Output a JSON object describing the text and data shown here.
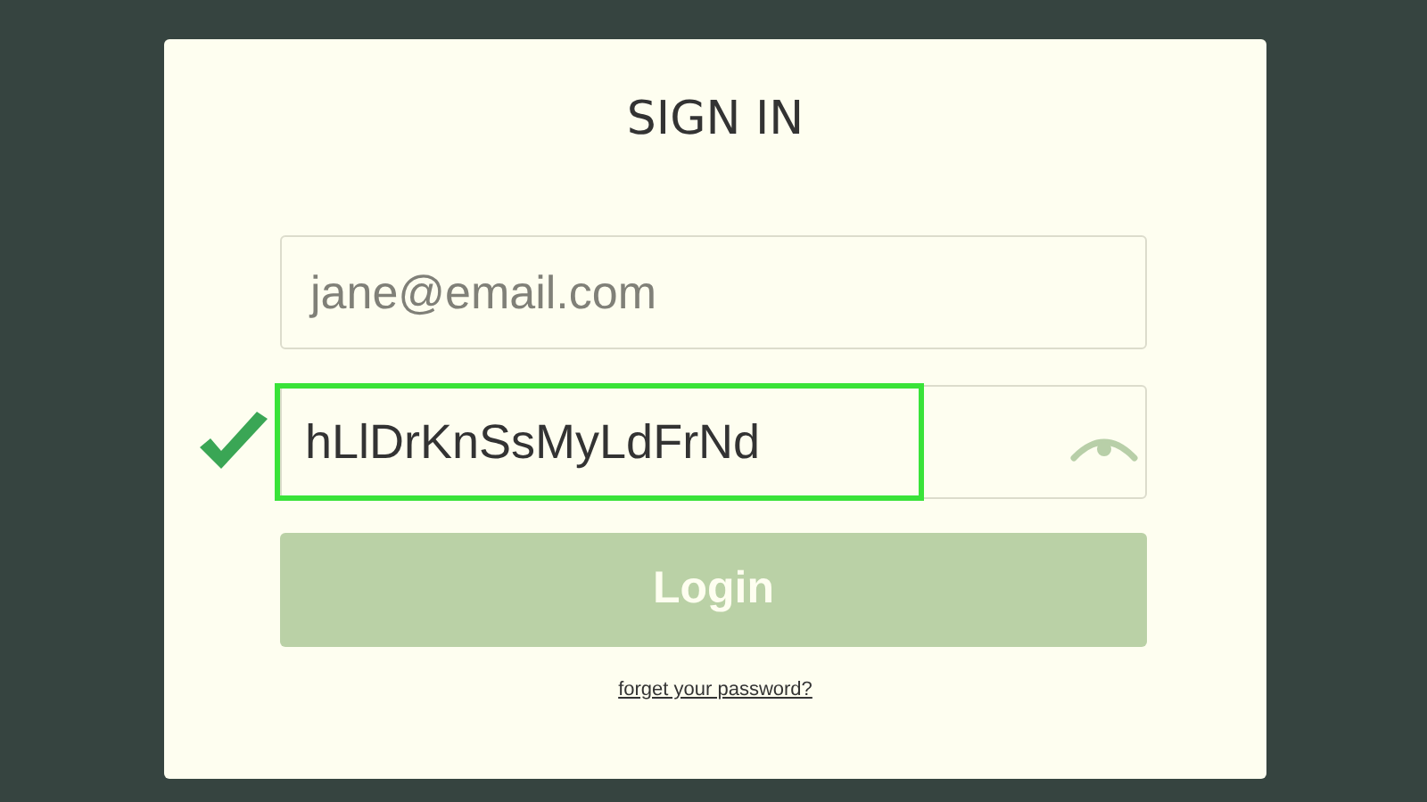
{
  "title": "SIGN IN",
  "email": {
    "placeholder": "jane@email.com"
  },
  "password": {
    "value": "hLlDrKnSsMyLdFrNd",
    "highlighted": true,
    "valid": true
  },
  "login_button": {
    "label": "Login",
    "disabled": true
  },
  "forgot_link": "forget your password?"
}
